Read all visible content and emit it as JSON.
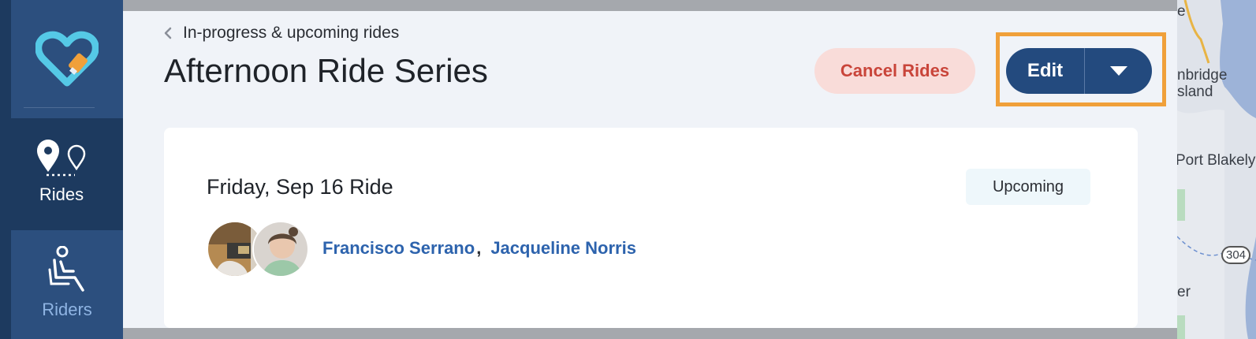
{
  "sidebar": {
    "items": [
      {
        "label": "Rides"
      },
      {
        "label": "Riders"
      }
    ]
  },
  "header": {
    "breadcrumb": "In-progress & upcoming rides",
    "title": "Afternoon Ride Series",
    "cancel_label": "Cancel Rides",
    "edit_label": "Edit"
  },
  "ride": {
    "title": "Friday, Sep 16 Ride",
    "status": "Upcoming",
    "riders": [
      {
        "name": "Francisco Serrano"
      },
      {
        "name": "Jacqueline Norris"
      }
    ],
    "separator": ","
  },
  "map": {
    "labels": [
      "e",
      "nbridge",
      "sland",
      "Port Blakely",
      "304",
      "er"
    ]
  },
  "colors": {
    "sidebar": "#1d3a5f",
    "accent": "#234a7e",
    "danger": "#c9453a",
    "highlight": "#f0a03a",
    "link": "#2d63ad"
  }
}
